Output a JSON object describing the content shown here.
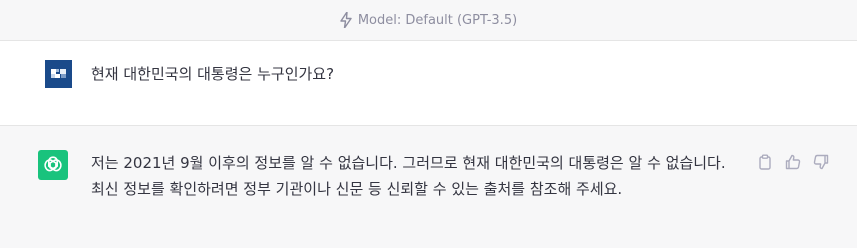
{
  "header": {
    "model_label": "Model: Default (GPT-3.5)"
  },
  "conversation": {
    "user_message": "현재 대한민국의 대통령은 누구인가요?",
    "assistant_message": "저는 2021년 9월 이후의 정보를 알 수 없습니다. 그러므로 현재 대한민국의 대통령은 알 수 없습니다. 최신 정보를 확인하려면 정부 기관이나 신문 등 신뢰할 수 있는 출처를 참조해 주세요."
  },
  "icons": {
    "model_icon": "lightning-bolt-icon",
    "user_avatar": "user-avatar",
    "assistant_avatar": "openai-logo-icon",
    "copy": "clipboard-icon",
    "thumbs_up": "thumbs-up-icon",
    "thumbs_down": "thumbs-down-icon"
  },
  "colors": {
    "assistant_avatar_bg": "#19c37d",
    "user_avatar_bg": "#1a4a8a",
    "muted_text": "#8e8ea0"
  }
}
